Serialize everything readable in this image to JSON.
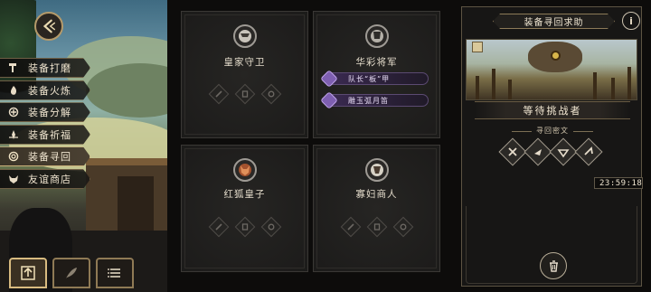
{
  "back_icon": "chevron-left-icon",
  "menu": [
    {
      "label": "装备打磨",
      "icon": "hammer-icon",
      "active": false
    },
    {
      "label": "装备火炼",
      "icon": "flame-icon",
      "active": false
    },
    {
      "label": "装备分解",
      "icon": "dissolve-icon",
      "active": false
    },
    {
      "label": "装备祈福",
      "icon": "bless-icon",
      "active": false
    },
    {
      "label": "装备寻回",
      "icon": "swirl-icon",
      "active": true
    },
    {
      "label": "友谊商店",
      "icon": "fox-icon",
      "active": false
    }
  ],
  "bottom_bar": [
    {
      "name": "upload-button",
      "icon": "upload-icon",
      "active": true
    },
    {
      "name": "feather-button",
      "icon": "feather-icon",
      "active": false
    },
    {
      "name": "list-button",
      "icon": "list-icon",
      "active": false
    }
  ],
  "slots": [
    {
      "name": "皇家守卫",
      "portrait": "royal-guard-portrait"
    },
    {
      "name": "华彩将军",
      "portrait": "general-portrait",
      "requirements": [
        {
          "label": "队长“板”甲"
        },
        {
          "label": "雕玉弧月笛"
        }
      ]
    },
    {
      "name": "红狐皇子",
      "portrait": "fox-prince-portrait"
    },
    {
      "name": "寡妇商人",
      "portrait": "widow-merchant-portrait"
    }
  ],
  "right_panel": {
    "title": "装备寻回求助",
    "info_icon": "info-icon",
    "info_label": "i",
    "challenger_label": "等待挑战者",
    "cipher_title": "寻回密文",
    "ciphers": [
      "rune-x-icon",
      "rune-beak-icon",
      "rune-wing-icon",
      "rune-hook-icon"
    ],
    "timer": "23:59:18",
    "trash_icon": "trash-icon"
  },
  "colors": {
    "gold": "#cbb07a",
    "purple": "#7e5fb0",
    "panel": "#1f1e1d"
  }
}
